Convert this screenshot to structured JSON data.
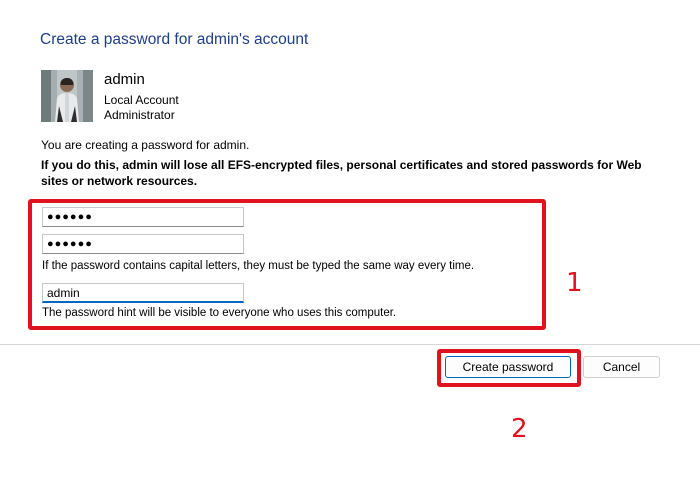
{
  "dialog": {
    "title": "Create a password for admin's account"
  },
  "account": {
    "name": "admin",
    "type": "Local Account",
    "role": "Administrator"
  },
  "messages": {
    "info": "You are creating a password for admin.",
    "warning": "If you do this, admin will lose all EFS-encrypted files, personal certificates and stored passwords for Web sites or network resources.",
    "caps_note": "If the password contains capital letters, they must be typed the same way every time.",
    "hint_note": "The password hint will be visible to everyone who uses this computer."
  },
  "fields": {
    "new_password_display": "●●●●●●",
    "confirm_password_display": "●●●●●●",
    "hint_value": "admin"
  },
  "buttons": {
    "create": "Create password",
    "cancel": "Cancel"
  },
  "callouts": {
    "one": "1",
    "two": "2"
  },
  "colors": {
    "title": "#1e3f87",
    "annotation": "#e1111e",
    "focus": "#0067c0"
  },
  "icons": {
    "avatar": "user-avatar-photo"
  }
}
